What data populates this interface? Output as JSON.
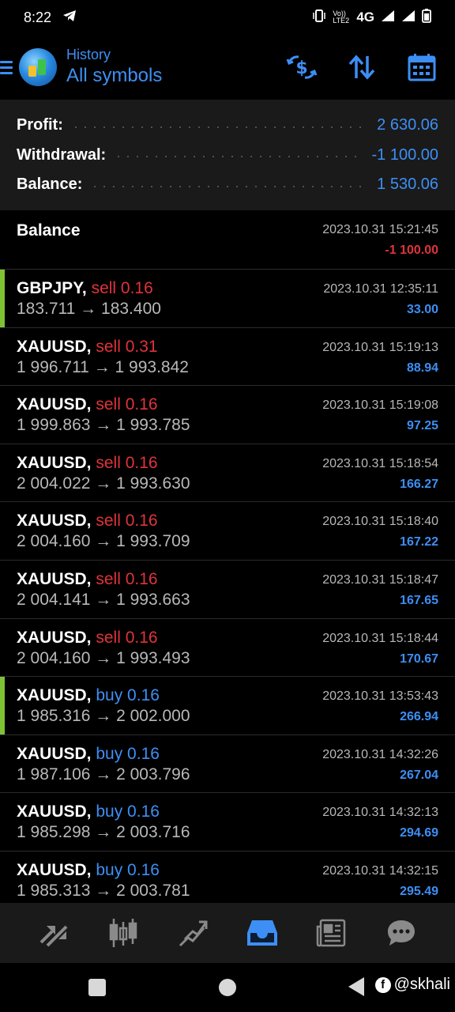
{
  "status_bar": {
    "time": "8:22",
    "network": "4G",
    "volte": "Vo)) LTE2"
  },
  "header": {
    "subtitle": "History",
    "title": "All symbols"
  },
  "summary": {
    "profit_label": "Profit:",
    "profit_value": "2 630.06",
    "withdrawal_label": "Withdrawal:",
    "withdrawal_value": "-1 100.00",
    "balance_label": "Balance:",
    "balance_value": "1 530.06"
  },
  "balance_entry": {
    "title": "Balance",
    "time": "2023.10.31 15:21:45",
    "amount": "-1 100.00"
  },
  "deals": [
    {
      "symbol": "GBPJPY,",
      "side": "sell 0.16",
      "direction": "sell",
      "prices": "183.711 → 183.400",
      "time": "2023.10.31 12:35:11",
      "profit": "33.00",
      "accent": true
    },
    {
      "symbol": "XAUUSD,",
      "side": "sell 0.31",
      "direction": "sell",
      "prices": "1 996.711 → 1 993.842",
      "time": "2023.10.31 15:19:13",
      "profit": "88.94",
      "accent": false
    },
    {
      "symbol": "XAUUSD,",
      "side": "sell 0.16",
      "direction": "sell",
      "prices": "1 999.863 → 1 993.785",
      "time": "2023.10.31 15:19:08",
      "profit": "97.25",
      "accent": false
    },
    {
      "symbol": "XAUUSD,",
      "side": "sell 0.16",
      "direction": "sell",
      "prices": "2 004.022 → 1 993.630",
      "time": "2023.10.31 15:18:54",
      "profit": "166.27",
      "accent": false
    },
    {
      "symbol": "XAUUSD,",
      "side": "sell 0.16",
      "direction": "sell",
      "prices": "2 004.160 → 1 993.709",
      "time": "2023.10.31 15:18:40",
      "profit": "167.22",
      "accent": false
    },
    {
      "symbol": "XAUUSD,",
      "side": "sell 0.16",
      "direction": "sell",
      "prices": "2 004.141 → 1 993.663",
      "time": "2023.10.31 15:18:47",
      "profit": "167.65",
      "accent": false
    },
    {
      "symbol": "XAUUSD,",
      "side": "sell 0.16",
      "direction": "sell",
      "prices": "2 004.160 → 1 993.493",
      "time": "2023.10.31 15:18:44",
      "profit": "170.67",
      "accent": false
    },
    {
      "symbol": "XAUUSD,",
      "side": "buy 0.16",
      "direction": "buy",
      "prices": "1 985.316 → 2 002.000",
      "time": "2023.10.31 13:53:43",
      "profit": "266.94",
      "accent": true
    },
    {
      "symbol": "XAUUSD,",
      "side": "buy 0.16",
      "direction": "buy",
      "prices": "1 987.106 → 2 003.796",
      "time": "2023.10.31 14:32:26",
      "profit": "267.04",
      "accent": false
    },
    {
      "symbol": "XAUUSD,",
      "side": "buy 0.16",
      "direction": "buy",
      "prices": "1 985.298 → 2 003.716",
      "time": "2023.10.31 14:32:13",
      "profit": "294.69",
      "accent": false
    },
    {
      "symbol": "XAUUSD,",
      "side": "buy 0.16",
      "direction": "buy",
      "prices": "1 985.313 → 2 003.781",
      "time": "2023.10.31 14:32:15",
      "profit": "295.49",
      "accent": false
    }
  ],
  "bottom_nav": {
    "items": [
      "quotes-icon",
      "chart-icon",
      "trade-icon",
      "history-icon",
      "news-icon",
      "chat-icon"
    ],
    "active": "history-icon"
  },
  "watermark": "@skhali",
  "colors": {
    "accent_blue": "#3d8ff5",
    "sell_red": "#e0333a",
    "accent_green": "#7fc234"
  }
}
